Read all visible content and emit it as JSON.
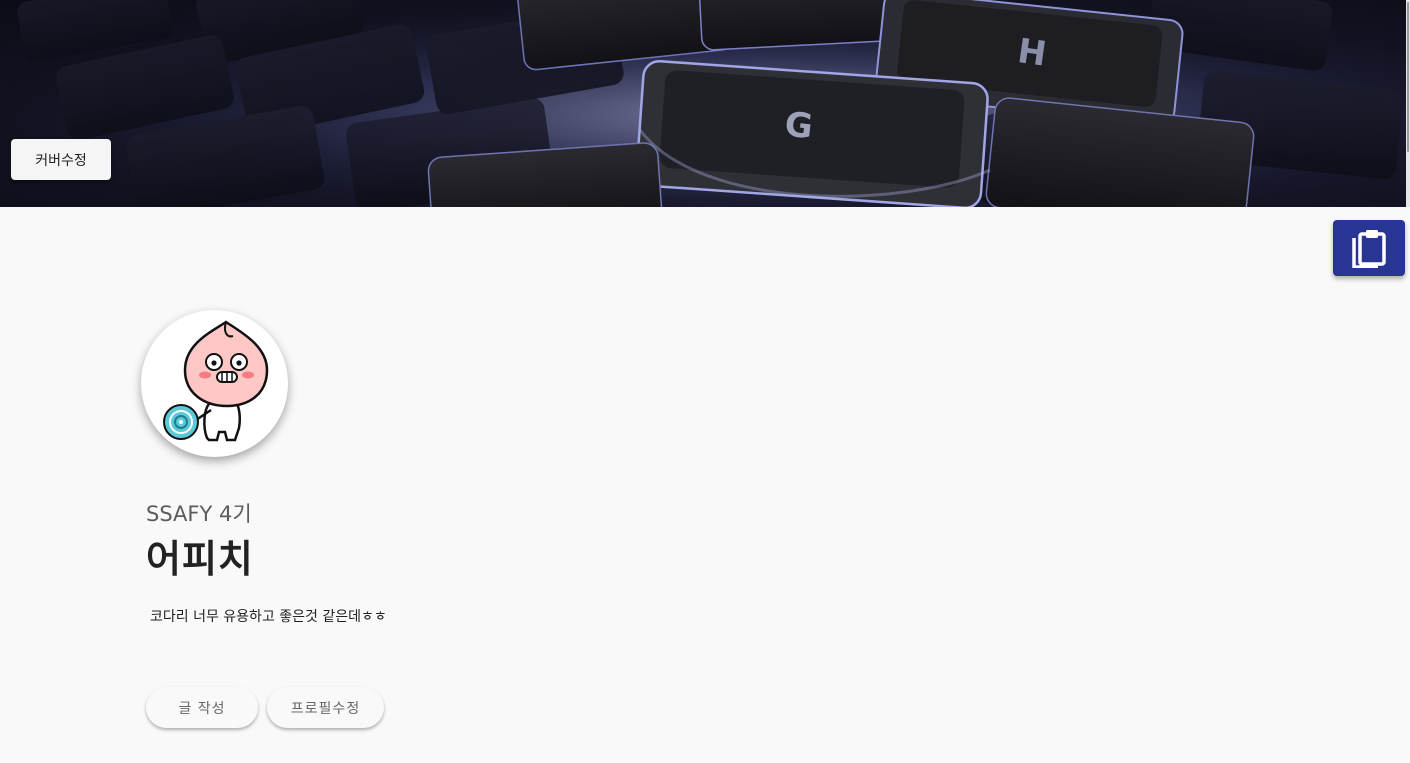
{
  "cover": {
    "image": "keyboard-keys-photo",
    "edit_button_label": "커버수정",
    "key_labels": [
      "G",
      "H"
    ]
  },
  "fab": {
    "icon": "clipboard-icon",
    "color": "#283593"
  },
  "profile": {
    "avatar": "apeach-character-avatar",
    "subtitle": "SSAFY 4기",
    "name": "어피치",
    "bio": "코다리 너무 유용하고 좋은것 같은데ㅎㅎ"
  },
  "actions": {
    "write_label": "글 작성",
    "edit_profile_label": "프로필수정"
  },
  "colors": {
    "background": "#f9f9f9",
    "primary": "#283593"
  }
}
